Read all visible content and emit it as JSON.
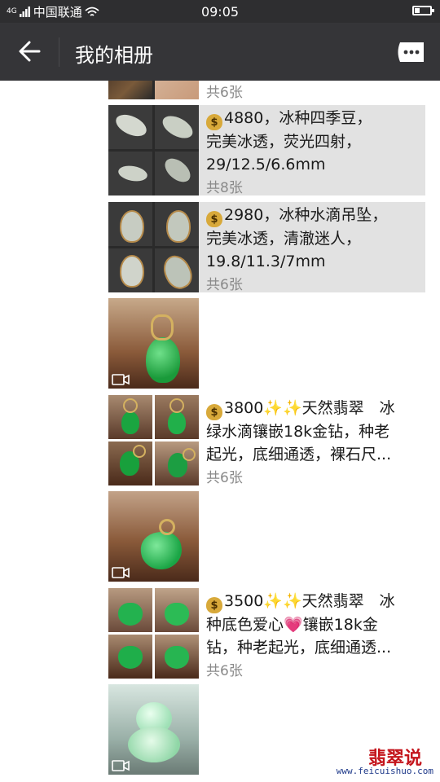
{
  "status_bar": {
    "network": "4G",
    "carrier": "中国联通",
    "time": "09:05",
    "battery_level": 0.35
  },
  "header": {
    "title": "我的相册",
    "back_icon": "arrow-left-icon",
    "more_icon": "more-icon"
  },
  "posts": [
    {
      "description": "",
      "count": "共6张",
      "shared": false
    },
    {
      "description": "4880，冰种四季豆，\n完美冰透，荧光四射，\n29/12.5/6.6mm",
      "count": "共8张",
      "shared": true
    },
    {
      "description": "2980，冰种水滴吊坠，\n完美冰透，清澈迷人，\n19.8/11.3/7mm",
      "count": "共6张",
      "shared": true
    },
    {
      "type": "video"
    },
    {
      "description": "3800✨✨天然翡翠　冰\n绿水滴镶嵌18k金钻，种老\n起光，底细通透，裸石尺...",
      "count": "共6张",
      "shared": false
    },
    {
      "type": "video"
    },
    {
      "description": "3500✨✨天然翡翠　冰\n种底色爱心💗镶嵌18k金\n钻，种老起光，底细通透...",
      "count": "共6张",
      "shared": false
    },
    {
      "type": "video"
    }
  ],
  "watermark": {
    "name": "翡翠说",
    "url": "www.feicuishuo.com"
  },
  "colors": {
    "statusbar": "#2e2e30",
    "navbar": "#353538",
    "shared_bg": "#e2e2e2",
    "count_text": "#8a8a8a",
    "watermark_red": "#c4151c",
    "watermark_blue": "#1f3a8a"
  }
}
